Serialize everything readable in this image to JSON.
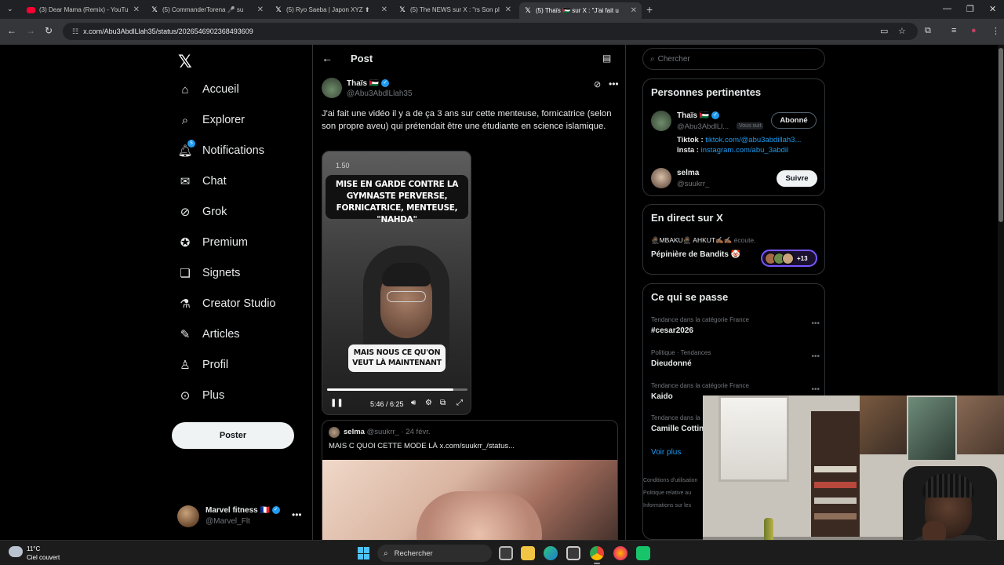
{
  "browser": {
    "tabs": [
      {
        "title": "(3) Dear Mama (Remix) - YouTu",
        "icon": "youtube-icon"
      },
      {
        "title": "(5) CommanderTorena 🎤 su",
        "icon": "x-icon"
      },
      {
        "title": "(5) Ryo Saeba | Japon XYZ ⬆",
        "icon": "x-icon"
      },
      {
        "title": "(5) The NEWS sur X : \"rs Son pl",
        "icon": "x-icon"
      },
      {
        "title": "(5) Thaïs 🇵🇸 sur X : \"J'ai fait u",
        "icon": "x-icon",
        "active": true
      }
    ],
    "url": "x.com/Abu3AbdlLlah35/status/2026546902368493609"
  },
  "nav": {
    "items": [
      {
        "label": "Accueil",
        "icon": "home-icon"
      },
      {
        "label": "Explorer",
        "icon": "search-icon"
      },
      {
        "label": "Notifications",
        "icon": "bell-icon",
        "badge": "5"
      },
      {
        "label": "Chat",
        "icon": "mail-icon"
      },
      {
        "label": "Grok",
        "icon": "grok-icon"
      },
      {
        "label": "Premium",
        "icon": "verified-icon"
      },
      {
        "label": "Signets",
        "icon": "bookmark-icon"
      },
      {
        "label": "Creator Studio",
        "icon": "flask-icon"
      },
      {
        "label": "Articles",
        "icon": "article-icon"
      },
      {
        "label": "Profil",
        "icon": "person-icon"
      },
      {
        "label": "Plus",
        "icon": "more-circle-icon"
      }
    ],
    "post_button": "Poster",
    "account": {
      "name": "Marvel fitness 🇫🇷",
      "handle": "@Marvel_Flt"
    }
  },
  "main": {
    "header_title": "Post",
    "author": {
      "name": "Thaïs 🇵🇸",
      "handle": "@Abu3AbdlLlah35"
    },
    "text": "J'ai fait une vidéo il y a de ça 3 ans sur cette menteuse, fornicatrice (selon son propre aveu) qui prétendait être une étudiante en science islamique.",
    "video": {
      "speed": "1.50",
      "caption_top": "MISE EN GARDE CONTRE LA GYMNASTE PERVERSE, FORNICATRICE, MENTEUSE, \"NAHDA\"",
      "caption_bottom": "MAIS NOUS CE QU'ON VEUT LÀ MAINTENANT",
      "time": "5:46 / 6:25",
      "progress": 0.899
    },
    "quote": {
      "name": "selma",
      "handle": "@suukrr_",
      "date": "· 24 févr.",
      "text": "MAIS C QUOI CETTE MODE LÀ  x.com/suukrr_/status..."
    }
  },
  "right": {
    "search_placeholder": "Chercher",
    "relevant": {
      "title": "Personnes pertinentes",
      "person1": {
        "name": "Thaïs 🇵🇸",
        "handle": "@Abu3AbdlLl...",
        "follows_you": "Vous suit",
        "button": "Abonné",
        "bio_line1_label": "Tiktok : ",
        "bio_line1_link": "tiktok.com/@abu3abdillah3...",
        "bio_line2_label": "Insta : ",
        "bio_line2_link": "instagram.com/abu_3abdil"
      },
      "person2": {
        "name": "selma",
        "handle": "@suukrr_",
        "button": "Suivre"
      }
    },
    "live": {
      "title": "En direct sur X",
      "hosts": "🥷🏾MBAKU🥷🏾 AHKUT✍🏾✍🏾",
      "hosts_suffix": "écoute.",
      "space": "Pépinière de Bandits 🤡",
      "count": "+13"
    },
    "trends": {
      "title": "Ce qui se passe",
      "items": [
        {
          "category": "Tendance dans la catégorie France",
          "name": "#cesar2026"
        },
        {
          "category": "Politique · Tendances",
          "name": "Dieudonné"
        },
        {
          "category": "Tendance dans la catégorie France",
          "name": "Kaido"
        },
        {
          "category": "Tendance dans la",
          "name": "Camille Cottin"
        }
      ],
      "see_more": "Voir plus"
    },
    "footer": [
      "Conditions d'utilisation",
      "Politique relative au",
      "Informations sur les"
    ]
  },
  "taskbar": {
    "temp": "11°C",
    "weather": "Ciel couvert",
    "search": "Rechercher"
  },
  "colors": {
    "accent": "#1d9bf0",
    "background": "#000000",
    "border": "#2f3336",
    "muted": "#71767b"
  }
}
